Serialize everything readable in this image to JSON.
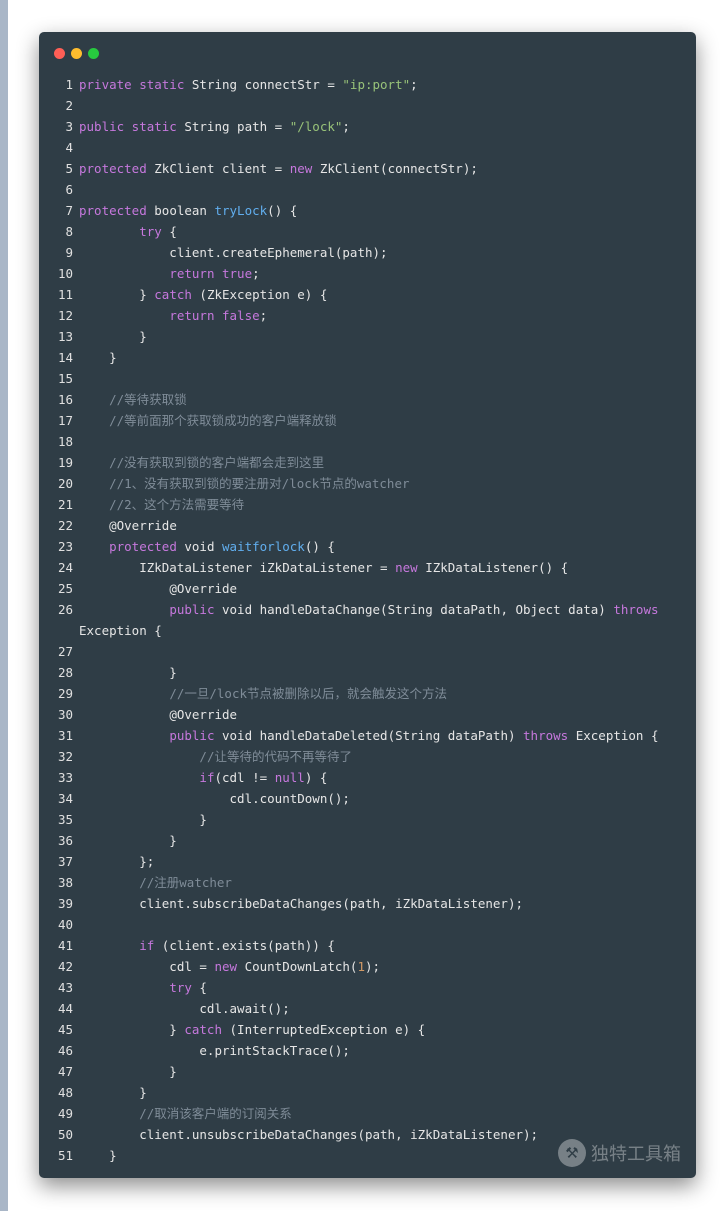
{
  "window": {
    "buttons": [
      {
        "name": "close",
        "color": "#ff5f56"
      },
      {
        "name": "minimize",
        "color": "#ffbd2e"
      },
      {
        "name": "zoom",
        "color": "#27c93f"
      }
    ]
  },
  "colors": {
    "keyword": "#c678dd",
    "function": "#61aeee",
    "string": "#98c379",
    "number": "#d19a66",
    "comment": "#7f8c98",
    "text": "#e6e6e6",
    "background": "#2f3d46"
  },
  "watermark": {
    "icon": "hammer-icon",
    "text": "独特工具箱"
  },
  "code": [
    {
      "n": "1",
      "t": [
        [
          "kw",
          "private static "
        ],
        [
          "",
          "String connectStr = "
        ],
        [
          "str",
          "\"ip:port\""
        ],
        [
          "",
          ";"
        ]
      ]
    },
    {
      "n": "2",
      "t": []
    },
    {
      "n": "3",
      "t": [
        [
          "kw",
          "public static "
        ],
        [
          "",
          "String path = "
        ],
        [
          "str",
          "\"/lock\""
        ],
        [
          "",
          ";"
        ]
      ]
    },
    {
      "n": "4",
      "t": []
    },
    {
      "n": "5",
      "t": [
        [
          "kw",
          "protected "
        ],
        [
          "",
          "ZkClient client = "
        ],
        [
          "kw",
          "new "
        ],
        [
          "",
          "ZkClient(connectStr);"
        ]
      ]
    },
    {
      "n": "6",
      "t": []
    },
    {
      "n": "7",
      "t": [
        [
          "kw",
          "protected "
        ],
        [
          "",
          "boolean "
        ],
        [
          "fn",
          "tryLock"
        ],
        [
          "",
          "() {"
        ]
      ]
    },
    {
      "n": "8",
      "t": [
        [
          "",
          "        "
        ],
        [
          "kw",
          "try"
        ],
        [
          "",
          " {"
        ]
      ]
    },
    {
      "n": "9",
      "t": [
        [
          "",
          "            client.createEphemeral(path);"
        ]
      ]
    },
    {
      "n": "10",
      "t": [
        [
          "",
          "            "
        ],
        [
          "kw",
          "return true"
        ],
        [
          "",
          ";"
        ]
      ]
    },
    {
      "n": "11",
      "t": [
        [
          "",
          "        } "
        ],
        [
          "kw",
          "catch"
        ],
        [
          "",
          " (ZkException e) {"
        ]
      ]
    },
    {
      "n": "12",
      "t": [
        [
          "",
          "            "
        ],
        [
          "kw",
          "return false"
        ],
        [
          "",
          ";"
        ]
      ]
    },
    {
      "n": "13",
      "t": [
        [
          "",
          "        }"
        ]
      ]
    },
    {
      "n": "14",
      "t": [
        [
          "",
          "    }"
        ]
      ]
    },
    {
      "n": "15",
      "t": []
    },
    {
      "n": "16",
      "t": [
        [
          "",
          "    "
        ],
        [
          "cm",
          "//等待获取锁"
        ]
      ]
    },
    {
      "n": "17",
      "t": [
        [
          "",
          "    "
        ],
        [
          "cm",
          "//等前面那个获取锁成功的客户端释放锁"
        ]
      ]
    },
    {
      "n": "18",
      "t": []
    },
    {
      "n": "19",
      "t": [
        [
          "",
          "    "
        ],
        [
          "cm",
          "//没有获取到锁的客户端都会走到这里"
        ]
      ]
    },
    {
      "n": "20",
      "t": [
        [
          "",
          "    "
        ],
        [
          "cm",
          "//1、没有获取到锁的要注册对/lock节点的watcher"
        ]
      ]
    },
    {
      "n": "21",
      "t": [
        [
          "",
          "    "
        ],
        [
          "cm",
          "//2、这个方法需要等待"
        ]
      ]
    },
    {
      "n": "22",
      "t": [
        [
          "",
          "    "
        ],
        [
          "ann",
          "@Override"
        ]
      ]
    },
    {
      "n": "23",
      "t": [
        [
          "",
          "    "
        ],
        [
          "kw",
          "protected "
        ],
        [
          "",
          "void "
        ],
        [
          "fn",
          "waitforlock"
        ],
        [
          "",
          "() {"
        ]
      ]
    },
    {
      "n": "24",
      "t": [
        [
          "",
          "        IZkDataListener iZkDataListener = "
        ],
        [
          "kw",
          "new "
        ],
        [
          "",
          "IZkDataListener() {"
        ]
      ]
    },
    {
      "n": "25",
      "t": [
        [
          "",
          "            "
        ],
        [
          "ann",
          "@Override"
        ]
      ]
    },
    {
      "n": "26",
      "t": [
        [
          "",
          "            "
        ],
        [
          "kw",
          "public "
        ],
        [
          "",
          "void handleDataChange(String dataPath, Object data) "
        ],
        [
          "kw",
          "throws"
        ]
      ]
    },
    {
      "n": "",
      "t": [
        [
          "",
          "Exception {"
        ]
      ]
    },
    {
      "n": "27",
      "t": []
    },
    {
      "n": "28",
      "t": [
        [
          "",
          "            }"
        ]
      ]
    },
    {
      "n": "29",
      "t": [
        [
          "",
          "            "
        ],
        [
          "cm",
          "//一旦/lock节点被删除以后，就会触发这个方法"
        ]
      ]
    },
    {
      "n": "30",
      "t": [
        [
          "",
          "            "
        ],
        [
          "ann",
          "@Override"
        ]
      ]
    },
    {
      "n": "31",
      "t": [
        [
          "",
          "            "
        ],
        [
          "kw",
          "public "
        ],
        [
          "",
          "void handleDataDeleted(String dataPath) "
        ],
        [
          "kw",
          "throws "
        ],
        [
          "",
          "Exception {"
        ]
      ]
    },
    {
      "n": "32",
      "t": [
        [
          "",
          "                "
        ],
        [
          "cm",
          "//让等待的代码不再等待了"
        ]
      ]
    },
    {
      "n": "33",
      "t": [
        [
          "",
          "                "
        ],
        [
          "kw",
          "if"
        ],
        [
          "",
          "(cdl != "
        ],
        [
          "kw",
          "null"
        ],
        [
          "",
          ") {"
        ]
      ]
    },
    {
      "n": "34",
      "t": [
        [
          "",
          "                    cdl.countDown();"
        ]
      ]
    },
    {
      "n": "35",
      "t": [
        [
          "",
          "                }"
        ]
      ]
    },
    {
      "n": "36",
      "t": [
        [
          "",
          "            }"
        ]
      ]
    },
    {
      "n": "37",
      "t": [
        [
          "",
          "        };"
        ]
      ]
    },
    {
      "n": "38",
      "t": [
        [
          "",
          "        "
        ],
        [
          "cm",
          "//注册watcher"
        ]
      ]
    },
    {
      "n": "39",
      "t": [
        [
          "",
          "        client.subscribeDataChanges(path, iZkDataListener);"
        ]
      ]
    },
    {
      "n": "40",
      "t": []
    },
    {
      "n": "41",
      "t": [
        [
          "",
          "        "
        ],
        [
          "kw",
          "if"
        ],
        [
          "",
          " (client.exists(path)) {"
        ]
      ]
    },
    {
      "n": "42",
      "t": [
        [
          "",
          "            cdl = "
        ],
        [
          "kw",
          "new "
        ],
        [
          "",
          "CountDownLatch("
        ],
        [
          "num",
          "1"
        ],
        [
          "",
          ");"
        ]
      ]
    },
    {
      "n": "43",
      "t": [
        [
          "",
          "            "
        ],
        [
          "kw",
          "try"
        ],
        [
          "",
          " {"
        ]
      ]
    },
    {
      "n": "44",
      "t": [
        [
          "",
          "                cdl.await();"
        ]
      ]
    },
    {
      "n": "45",
      "t": [
        [
          "",
          "            } "
        ],
        [
          "kw",
          "catch"
        ],
        [
          "",
          " (InterruptedException e) {"
        ]
      ]
    },
    {
      "n": "46",
      "t": [
        [
          "",
          "                e.printStackTrace();"
        ]
      ]
    },
    {
      "n": "47",
      "t": [
        [
          "",
          "            }"
        ]
      ]
    },
    {
      "n": "48",
      "t": [
        [
          "",
          "        }"
        ]
      ]
    },
    {
      "n": "49",
      "t": [
        [
          "",
          "        "
        ],
        [
          "cm",
          "//取消该客户端的订阅关系"
        ]
      ]
    },
    {
      "n": "50",
      "t": [
        [
          "",
          "        client.unsubscribeDataChanges(path, iZkDataListener);"
        ]
      ]
    },
    {
      "n": "51",
      "t": [
        [
          "",
          "    }"
        ]
      ]
    }
  ]
}
